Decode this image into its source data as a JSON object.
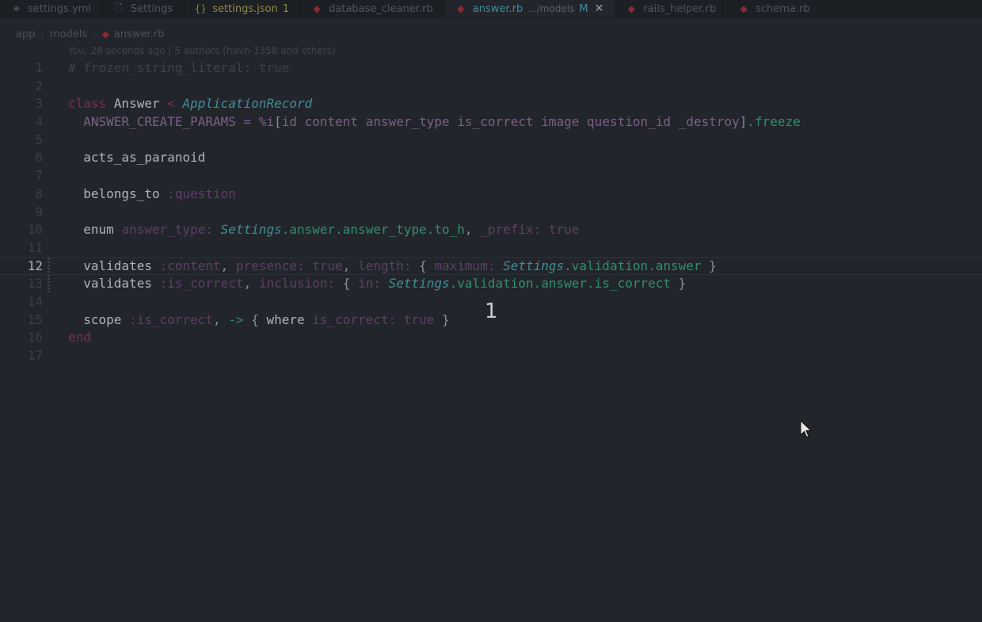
{
  "tabs": [
    {
      "icon": "yaml-icon",
      "glyph": "≋",
      "label": "settings.yml",
      "type": "yaml"
    },
    {
      "icon": "file-icon",
      "glyph": "🗋",
      "label": "Settings",
      "type": "file"
    },
    {
      "icon": "json-icon",
      "glyph": "{}",
      "label": "settings.json",
      "badge": "1",
      "type": "json"
    },
    {
      "icon": "ruby-icon",
      "glyph": "◆",
      "label": "database_cleaner.rb",
      "type": "ruby"
    },
    {
      "icon": "ruby-icon",
      "glyph": "◆",
      "label": "answer.rb",
      "description": ".../models",
      "modified": "M",
      "close": "✕",
      "type": "ruby",
      "active": true
    },
    {
      "icon": "ruby-icon",
      "glyph": "◆",
      "label": "rails_helper.rb",
      "type": "ruby"
    },
    {
      "icon": "ruby-icon",
      "glyph": "◆",
      "label": "schema.rb",
      "type": "ruby"
    }
  ],
  "breadcrumb": {
    "parts": [
      "app",
      "models"
    ],
    "file": "answer.rb",
    "separator": "›"
  },
  "blame": "You, 28 seconds ago | 5 authors (havh-1358 and others)",
  "code_lines": [
    {
      "n": "1",
      "tokens": [
        [
          "c",
          "# frozen_string_literal: true"
        ]
      ]
    },
    {
      "n": "2",
      "tokens": []
    },
    {
      "n": "3",
      "tokens": [
        [
          "k",
          "class "
        ],
        [
          "b",
          "Answer "
        ],
        [
          "k",
          "< "
        ],
        [
          "i",
          "ApplicationRecord"
        ]
      ]
    },
    {
      "n": "4",
      "tokens": [
        [
          "x",
          "  ANSWER_CREATE_PARAMS = %i"
        ],
        [
          "p",
          "["
        ],
        [
          "x",
          "id content answer_type is_correct image question_id _destroy"
        ],
        [
          "p",
          "]"
        ],
        [
          "g",
          ".freeze"
        ]
      ]
    },
    {
      "n": "5",
      "tokens": []
    },
    {
      "n": "6",
      "tokens": [
        [
          "b",
          "  acts_as_paranoid"
        ]
      ]
    },
    {
      "n": "7",
      "tokens": []
    },
    {
      "n": "8",
      "tokens": [
        [
          "b",
          "  belongs_to "
        ],
        [
          "s",
          ":question"
        ]
      ]
    },
    {
      "n": "9",
      "tokens": []
    },
    {
      "n": "10",
      "tokens": [
        [
          "b",
          "  enum "
        ],
        [
          "s",
          "answer_type: "
        ],
        [
          "i",
          "Settings"
        ],
        [
          "g",
          ".answer.answer_type.to_h"
        ],
        [
          "p",
          ", "
        ],
        [
          "s",
          "_prefix: true"
        ]
      ]
    },
    {
      "n": "11",
      "tokens": []
    },
    {
      "n": "12",
      "tokens": [
        [
          "b",
          "  validates "
        ],
        [
          "s",
          ":content"
        ],
        [
          "p",
          ", "
        ],
        [
          "s",
          "presence: true"
        ],
        [
          "p",
          ", "
        ],
        [
          "s",
          "length: "
        ],
        [
          "p",
          "{ "
        ],
        [
          "s",
          "maximum: "
        ],
        [
          "i",
          "Settings"
        ],
        [
          "g",
          ".validation.answer"
        ],
        [
          "p",
          " }"
        ]
      ],
      "current": true
    },
    {
      "n": "13",
      "tokens": [
        [
          "b",
          "  validates "
        ],
        [
          "s",
          ":is_correct"
        ],
        [
          "p",
          ", "
        ],
        [
          "s",
          "inclusion: "
        ],
        [
          "p",
          "{ "
        ],
        [
          "s",
          "in: "
        ],
        [
          "i",
          "Settings"
        ],
        [
          "g",
          ".validation.answer.is_correct"
        ],
        [
          "p",
          " }"
        ]
      ]
    },
    {
      "n": "14",
      "tokens": []
    },
    {
      "n": "15",
      "tokens": [
        [
          "b",
          "  scope "
        ],
        [
          "s",
          ":is_correct"
        ],
        [
          "p",
          ", "
        ],
        [
          "g",
          "->"
        ],
        [
          "p",
          " { "
        ],
        [
          "b",
          "where "
        ],
        [
          "s",
          "is_correct: true"
        ],
        [
          "p",
          " }"
        ]
      ]
    },
    {
      "n": "16",
      "tokens": [
        [
          "k",
          "end"
        ]
      ]
    },
    {
      "n": "17",
      "tokens": []
    }
  ],
  "overlay_number": "1",
  "colors": {
    "background": "#22252b",
    "accent": "#3f8f95",
    "keyword": "#7a2e56",
    "symbol": "#5d3f66",
    "method": "#2f8f6a"
  }
}
